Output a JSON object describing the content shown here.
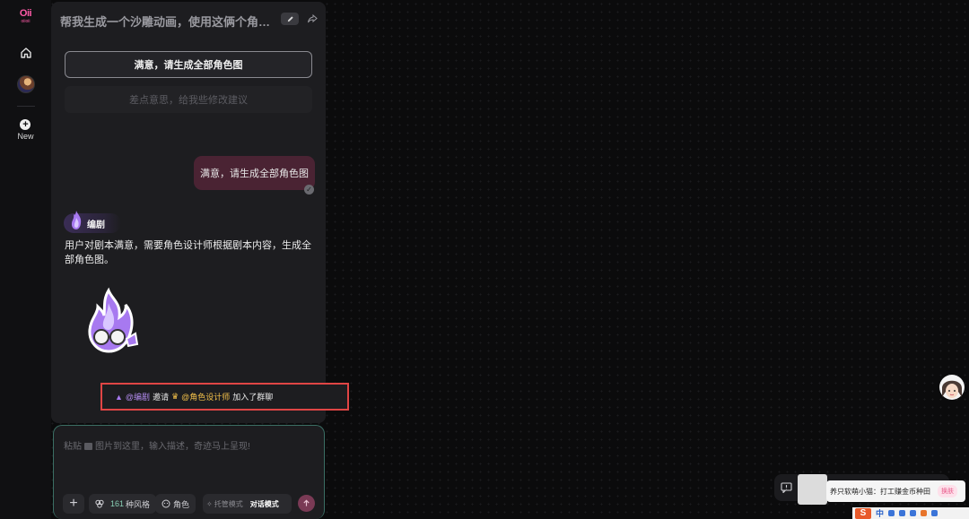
{
  "rail": {
    "logo_text": "Oii",
    "logo_sub": "oiioii",
    "new_label": "New"
  },
  "chat": {
    "title": "帮我生成一个沙雕动画，使用这俩个角色...",
    "option_primary": "满意，请生成全部角色图",
    "option_secondary": "差点意思，给我些修改建议",
    "user_message": "满意，请生成全部角色图",
    "agent_name": "编剧",
    "agent_message": "用户对剧本满意，需要角色设计师根据剧本内容，生成全部角色图。",
    "notice": {
      "from": "@编剧",
      "verb": "邀请",
      "to": "@角色设计师",
      "suffix": "加入了群聊"
    }
  },
  "composer": {
    "placeholder_pre": "粘贴",
    "placeholder_post": "图片到这里，输入描述，奇迹马上呈现!",
    "style_count": "161",
    "style_label": "种风格",
    "role_label": "角色",
    "mode_off": "托管模式",
    "mode_on": "对话模式"
  },
  "promo": {
    "text": "养只软萌小猫：打工赚金币种田",
    "tag": "换肤"
  },
  "ime": {
    "logo": "S",
    "lang": "中"
  },
  "colors": {
    "accent_pink": "#ff5aa8",
    "user_bubble": "#4a2333",
    "notice_border": "#e04545",
    "mention_purple": "#b48cf0",
    "mention_gold": "#f3c04a"
  }
}
